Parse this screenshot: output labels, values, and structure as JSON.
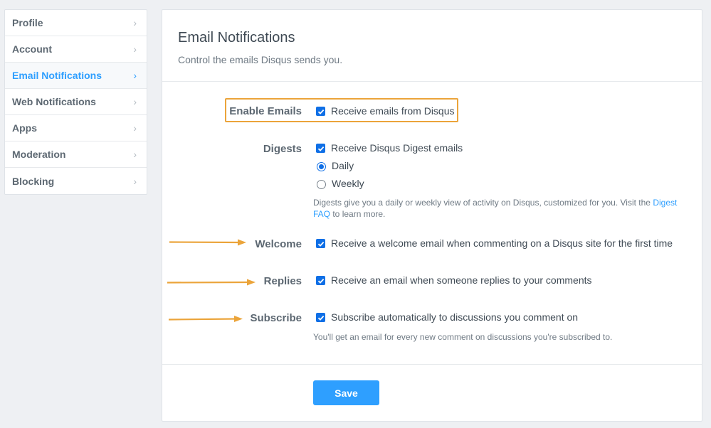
{
  "sidebar": {
    "items": [
      {
        "label": "Profile"
      },
      {
        "label": "Account"
      },
      {
        "label": "Email Notifications"
      },
      {
        "label": "Web Notifications"
      },
      {
        "label": "Apps"
      },
      {
        "label": "Moderation"
      },
      {
        "label": "Blocking"
      }
    ],
    "active": "Email Notifications"
  },
  "header": {
    "title": "Email Notifications",
    "subtitle": "Control the emails Disqus sends you."
  },
  "settings": {
    "enable_emails": {
      "label": "Enable Emails",
      "option": "Receive emails from Disqus",
      "checked": true
    },
    "digests": {
      "label": "Digests",
      "option": "Receive Disqus Digest emails",
      "checked": true,
      "frequency_options": [
        "Daily",
        "Weekly"
      ],
      "selected_frequency": "Daily",
      "help_prefix": "Digests give you a daily or weekly view of activity on Disqus, customized for you. Visit the ",
      "help_link_1": "Digest",
      "help_link_2": "FAQ",
      "help_suffix": " to learn more."
    },
    "welcome": {
      "label": "Welcome",
      "option": "Receive a welcome email when commenting on a Disqus site for the first time",
      "checked": true
    },
    "replies": {
      "label": "Replies",
      "option": "Receive an email when someone replies to your comments",
      "checked": true
    },
    "subscribe": {
      "label": "Subscribe",
      "option": "Subscribe automatically to discussions you comment on",
      "checked": true,
      "help": "You'll get an email for every new comment on discussions you're subscribed to."
    }
  },
  "actions": {
    "save_label": "Save"
  },
  "colors": {
    "accent": "#2e9fff",
    "highlight": "#eba43a",
    "checkbox": "#0f6fe6"
  },
  "icons": {
    "sidebar_chevron": "chevron-right-icon",
    "annotation_arrow": "arrow-right-icon"
  }
}
